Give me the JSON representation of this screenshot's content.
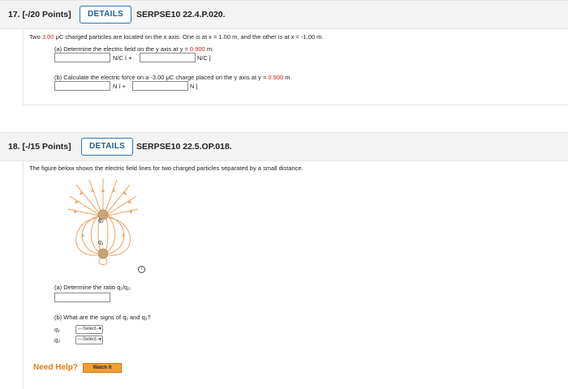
{
  "q17": {
    "points": "17.  [-/20 Points]",
    "details": "DETAILS",
    "code": "SERPSE10 22.4.P.020.",
    "intro_a": "Two ",
    "intro_charge": "3.00",
    "intro_b": " μC charged particles are located on the x axis. One is at x = 1.00 m, and the other is at x = -1.00 m.",
    "part_a_a": "(a) Determine the electric field on the y axis at y = ",
    "part_a_y": "0.900",
    "part_a_b": " m.",
    "part_a_unit1": "N/C î +",
    "part_a_unit2": "N/C ĵ",
    "part_b_a": "(b) Calculate the electric force on a -3.00 μC charge placed on the y axis at y = ",
    "part_b_y": "0.900",
    "part_b_b": " m.",
    "part_b_unit1": "N î +",
    "part_b_unit2": "N ĵ"
  },
  "q18": {
    "points": "18.  [-/15 Points]",
    "details": "DETAILS",
    "code": "SERPSE10 22.5.OP.018.",
    "intro": "The figure below shows the electric field lines for two charged particles separated by a small distance.",
    "q2_label": "q₂",
    "q1_label": "q₁",
    "info": "i",
    "part_a": "(a) Determine the ratio q₁/q₂.",
    "part_b": "(b) What are the signs of q₁ and q₂?",
    "sel1_label": "q₁",
    "sel2_label": "q₂",
    "select_placeholder": "---Select---"
  },
  "help": {
    "need_help": "Need Help?",
    "watch": "Watch It"
  },
  "colors": {
    "field_line": "#f0a060",
    "charge": "#c9a27a",
    "accent_red": "#d0261d",
    "help_orange": "#e07b18"
  }
}
